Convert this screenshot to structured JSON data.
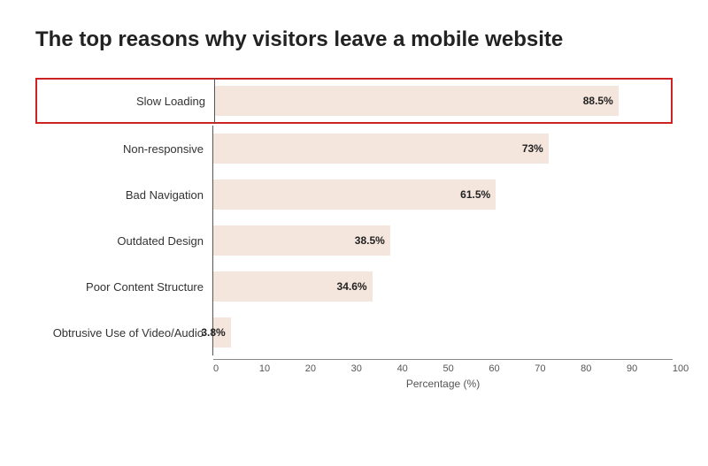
{
  "title": "The top reasons why visitors leave a mobile website",
  "chart": {
    "bars": [
      {
        "label": "Slow Loading",
        "value": 88.5,
        "display": "88.5%",
        "highlighted": true
      },
      {
        "label": "Non-responsive",
        "value": 73,
        "display": "73%",
        "highlighted": false
      },
      {
        "label": "Bad Navigation",
        "value": 61.5,
        "display": "61.5%",
        "highlighted": false
      },
      {
        "label": "Outdated Design",
        "value": 38.5,
        "display": "38.5%",
        "highlighted": false
      },
      {
        "label": "Poor Content Structure",
        "value": 34.6,
        "display": "34.6%",
        "highlighted": false
      },
      {
        "label": "Obtrusive Use of Video/Audio",
        "value": 3.8,
        "display": "3.8%",
        "highlighted": false
      }
    ],
    "xAxis": {
      "ticks": [
        "0",
        "10",
        "20",
        "30",
        "40",
        "50",
        "60",
        "70",
        "80",
        "90",
        "100"
      ],
      "title": "Percentage (%)"
    }
  }
}
